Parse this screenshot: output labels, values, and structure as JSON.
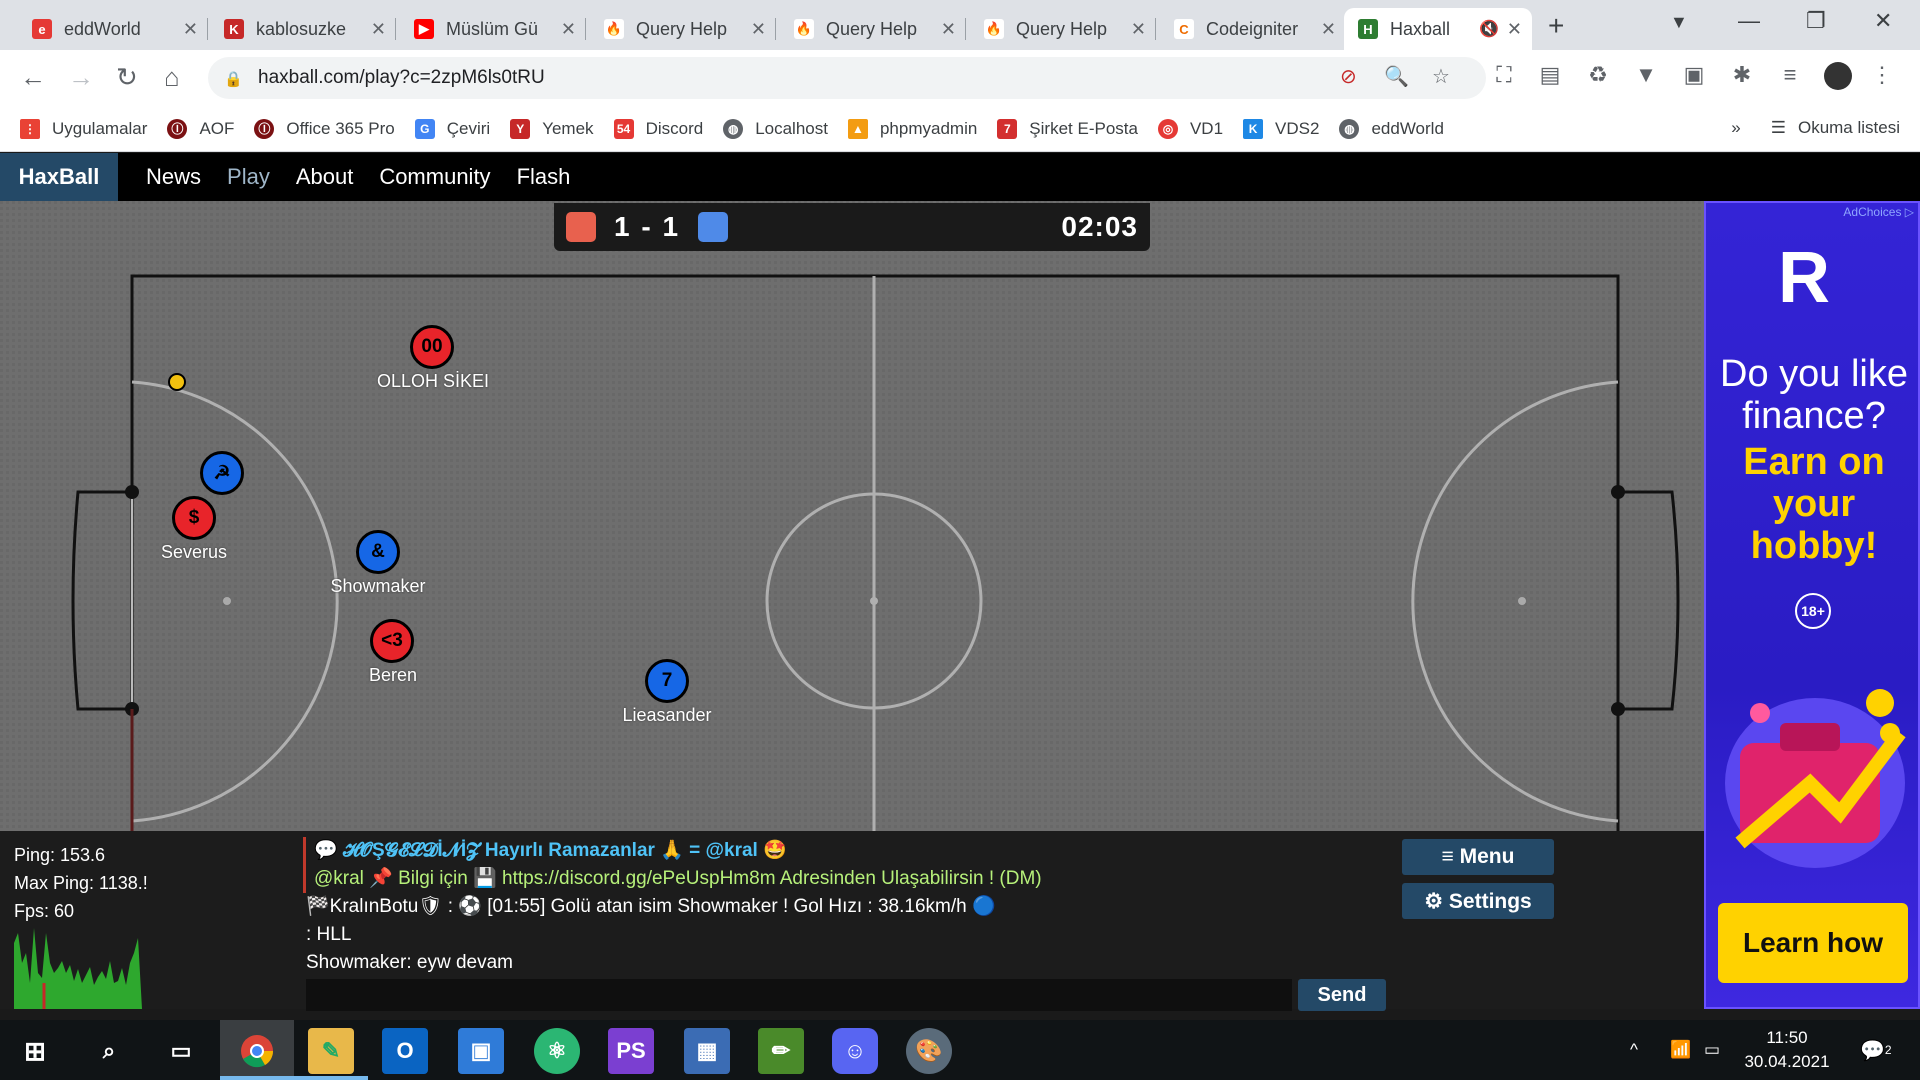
{
  "browser": {
    "tabs": [
      {
        "title": "eddWorld",
        "color": "#e53935",
        "glyph": "e"
      },
      {
        "title": "kablosuzke",
        "color": "#c62828",
        "glyph": "K"
      },
      {
        "title": "Müslüm Gü",
        "color": "#ff0000",
        "glyph": "▶"
      },
      {
        "title": "Query Help",
        "color": "#f4511e",
        "glyph": "🔥"
      },
      {
        "title": "Query Help",
        "color": "#f4511e",
        "glyph": "🔥"
      },
      {
        "title": "Query Help",
        "color": "#f4511e",
        "glyph": "🔥"
      },
      {
        "title": "Codeigniter",
        "color": "#ef6c00",
        "glyph": "C"
      },
      {
        "title": "Haxball",
        "color": "#2e7d32",
        "glyph": "H"
      }
    ],
    "url": "haxball.com/play?c=2zpM6ls0tRU",
    "bookmarks": [
      {
        "label": "Uygulamalar",
        "color": "#e94235"
      },
      {
        "label": "AOF",
        "color": "#7b1113"
      },
      {
        "label": "Office 365 Pro",
        "color": "#7b1113"
      },
      {
        "label": "Çeviri",
        "color": "#4285f4"
      },
      {
        "label": "Yemek",
        "color": "#c62828"
      },
      {
        "label": "Discord",
        "color": "#e53935"
      },
      {
        "label": "Localhost",
        "color": "#5f6368"
      },
      {
        "label": "phpmyadmin",
        "color": "#f39c12"
      },
      {
        "label": "Şirket E-Posta",
        "color": "#d32f2f"
      },
      {
        "label": "VD1",
        "color": "#e53935"
      },
      {
        "label": "VDS2",
        "color": "#1e88e5"
      },
      {
        "label": "eddWorld",
        "color": "#5f6368"
      }
    ],
    "more": "»",
    "reading_list": "Okuma listesi"
  },
  "haxball": {
    "logo": "HaxBall",
    "nav": [
      "News",
      "Play",
      "About",
      "Community",
      "Flash"
    ],
    "score": "1 - 1",
    "time": "02:03",
    "red_color": "#e8614e",
    "blue_color": "#4f8ae8",
    "players": [
      {
        "number": "00",
        "name": "OLLOH SİKEI",
        "team": "red"
      },
      {
        "number": "☭",
        "name": "",
        "team": "blue"
      },
      {
        "number": "$",
        "name": "Severus",
        "team": "red"
      },
      {
        "number": "&",
        "name": "Showmaker",
        "team": "blue"
      },
      {
        "number": "<3",
        "name": "Beren",
        "team": "red"
      },
      {
        "number": "7",
        "name": "Lieasander",
        "team": "blue"
      }
    ],
    "stats": {
      "ping": "Ping: 153.6",
      "max_ping": "Max Ping: 1138.!",
      "fps": "Fps: 60"
    },
    "chat": [
      {
        "icon": "💬",
        "welcome": "𝓗𝓞Ş𝓖𝓔𝓛𝓓İ𝓝İ𝓩",
        "text": " Hayırlı Ramazanlar 🙏 = @kral 🤩"
      },
      {
        "text": "@kral 📌 Bilgi için 💾 https://discord.gg/ePeUspHm8m Adresinden Ulaşabilirsin ! (DM)"
      },
      {
        "text": "🏁KralınBotu🛡 : ⚽ [01:55] Golü atan isim Showmaker ! Gol Hızı : 38.16km/h 🔵"
      },
      {
        "text": ": HLL"
      },
      {
        "text": "Showmaker: eyw devam"
      }
    ],
    "send_label": "Send",
    "menu_label": "≡ Menu",
    "settings_label": "⚙ Settings"
  },
  "ad": {
    "choices": "AdChoices ▷",
    "question": "Do you like finance?",
    "earn": "Earn on your hobby!",
    "age": "18+",
    "cta": "Learn how"
  },
  "taskbar": {
    "time": "11:50",
    "date": "30.04.2021",
    "notifications": "2"
  }
}
